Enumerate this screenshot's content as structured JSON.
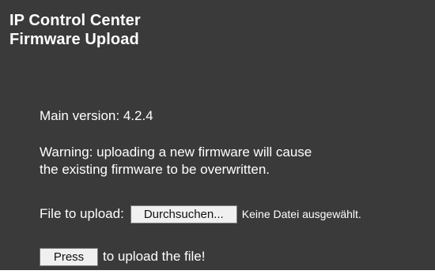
{
  "header": {
    "title_line1": "IP Control Center",
    "title_line2": "Firmware Upload"
  },
  "info": {
    "version_text": "Main version: 4.2.4",
    "warning_line1": "Warning: uploading a new firmware will cause",
    "warning_line2": "the existing firmware to be overwritten."
  },
  "upload": {
    "file_label": "File to upload:",
    "browse_button": "Durchsuchen...",
    "no_file_text": "Keine Datei ausgewählt."
  },
  "submit": {
    "press_button": "Press",
    "press_text": "to upload the file!"
  },
  "colors": {
    "panel_background": "#3a3a3a",
    "text": "#ffffff",
    "button_background": "#f0f0f0"
  }
}
